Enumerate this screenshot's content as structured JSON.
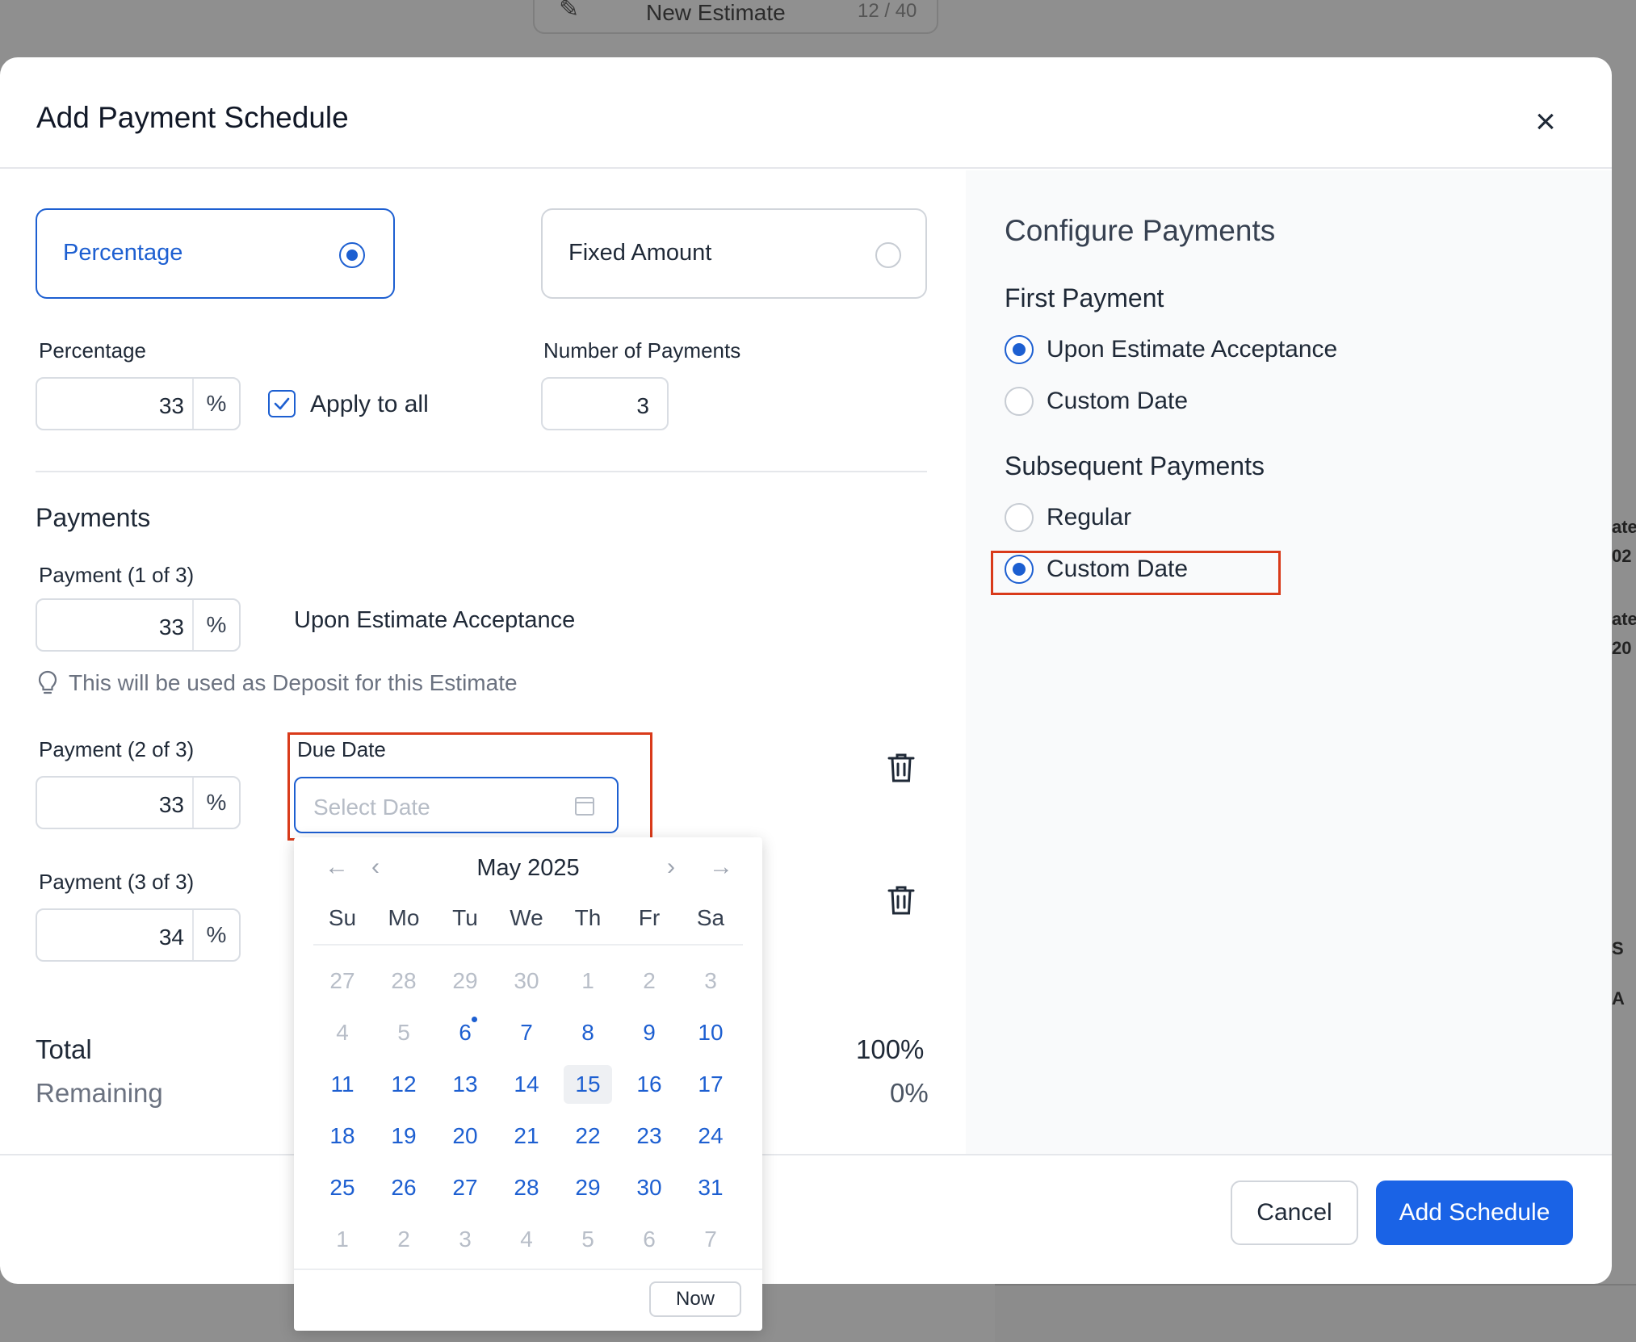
{
  "background": {
    "estimate_title": "New Estimate",
    "estimate_count": "12 / 40",
    "right_strip": [
      "ate",
      "02",
      "ate",
      "20",
      "S",
      "A"
    ]
  },
  "modal": {
    "title": "Add Payment Schedule",
    "close_glyph": "×"
  },
  "type_options": [
    {
      "label": "Percentage",
      "selected": true
    },
    {
      "label": "Fixed Amount",
      "selected": false
    }
  ],
  "settings": {
    "percentage_label": "Percentage",
    "percentage_value": "33",
    "percent_unit": "%",
    "apply_to_all_label": "Apply to all",
    "apply_to_all_checked": true,
    "num_payments_label": "Number of Payments",
    "num_payments_value": "3"
  },
  "payments_section": {
    "title": "Payments",
    "items": [
      {
        "label": "Payment (1 of 3)",
        "value": "33",
        "unit": "%",
        "timing": "Upon Estimate Acceptance",
        "hint": "This will be used as Deposit for this Estimate"
      },
      {
        "label": "Payment (2 of 3)",
        "value": "33",
        "unit": "%",
        "due_label": "Due Date",
        "due_placeholder": "Select Date"
      },
      {
        "label": "Payment (3 of 3)",
        "value": "34",
        "unit": "%"
      }
    ],
    "total_label": "Total",
    "total_value": "100%",
    "remaining_label": "Remaining",
    "remaining_value": "0%"
  },
  "calendar": {
    "month_label": "May 2025",
    "weekdays": [
      "Su",
      "Mo",
      "Tu",
      "We",
      "Th",
      "Fr",
      "Sa"
    ],
    "days": [
      [
        "27",
        "28",
        "29",
        "30",
        "1",
        "2",
        "3"
      ],
      [
        "4",
        "5",
        "6",
        "7",
        "8",
        "9",
        "10"
      ],
      [
        "11",
        "12",
        "13",
        "14",
        "15",
        "16",
        "17"
      ],
      [
        "18",
        "19",
        "20",
        "21",
        "22",
        "23",
        "24"
      ],
      [
        "25",
        "26",
        "27",
        "28",
        "29",
        "30",
        "31"
      ],
      [
        "1",
        "2",
        "3",
        "4",
        "5",
        "6",
        "7"
      ]
    ],
    "today_marker": "6",
    "hovered": "15",
    "now_label": "Now"
  },
  "configure": {
    "title": "Configure Payments",
    "first_payment": {
      "title": "First Payment",
      "options": [
        {
          "label": "Upon Estimate Acceptance",
          "selected": true
        },
        {
          "label": "Custom Date",
          "selected": false
        }
      ]
    },
    "subsequent_payments": {
      "title": "Subsequent Payments",
      "options": [
        {
          "label": "Regular",
          "selected": false
        },
        {
          "label": "Custom Date",
          "selected": true
        }
      ]
    }
  },
  "footer": {
    "cancel_label": "Cancel",
    "add_label": "Add Schedule"
  },
  "colors": {
    "accent": "#1d5fd1",
    "primary_button": "#1a63e6",
    "highlight": "#d93a1a",
    "overlay": "#8f8f8f"
  }
}
